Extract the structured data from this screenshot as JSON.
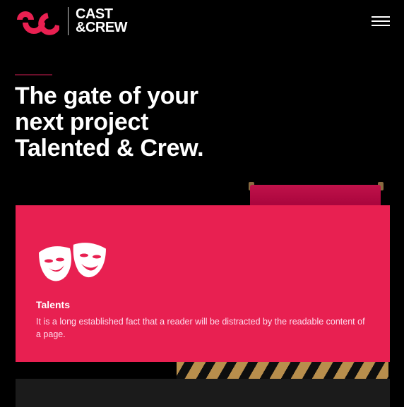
{
  "header": {
    "logo_line1": "CAST",
    "logo_line2": "&CREW",
    "brand_color": "#e82051"
  },
  "hero": {
    "line1": "The gate of your",
    "line2": "next project",
    "line3": "Talented & Crew."
  },
  "feature_card": {
    "icon": "theatre-masks-icon",
    "title": "Talents",
    "text": "It is a long established fact that a reader will be distracted by the readable content of a page."
  }
}
